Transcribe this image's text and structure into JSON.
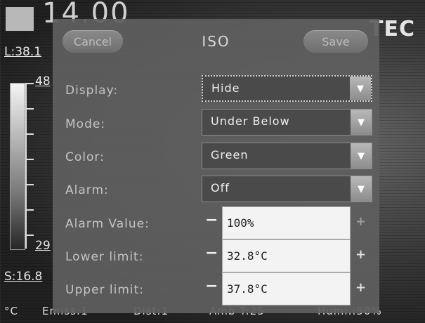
{
  "background": {
    "top_temperature": "14.00",
    "brand": "TEC",
    "max_label": "L:38.1",
    "min_label": "S:16.8",
    "scale_top": "48",
    "scale_bottom": "29",
    "status": {
      "unit": "°C",
      "emissivity": "Emiss:1",
      "distance": "Dist:1",
      "ambient": "Amb T:25",
      "humidity": "Humi.:50%"
    }
  },
  "dialog": {
    "title": "ISO",
    "cancel_label": "Cancel",
    "save_label": "Save",
    "fields": {
      "display": {
        "label": "Display:",
        "value": "Hide"
      },
      "mode": {
        "label": "Mode:",
        "value": "Under Below"
      },
      "color": {
        "label": "Color:",
        "value": "Green"
      },
      "alarm": {
        "label": "Alarm:",
        "value": "Off"
      },
      "alarm_value": {
        "label": "Alarm Value:",
        "value": "100%"
      },
      "lower_limit": {
        "label": "Lower limit:",
        "value": "32.8°C"
      },
      "upper_limit": {
        "label": "Upper limit:",
        "value": "37.8°C"
      }
    },
    "minus_symbol": "−",
    "plus_symbol": "+",
    "dropdown_arrow": "▼"
  },
  "colors": {
    "dialog_bg": "#5f5f5f",
    "field_bg": "#4a4a4a",
    "input_bg": "#f3f3f3"
  }
}
